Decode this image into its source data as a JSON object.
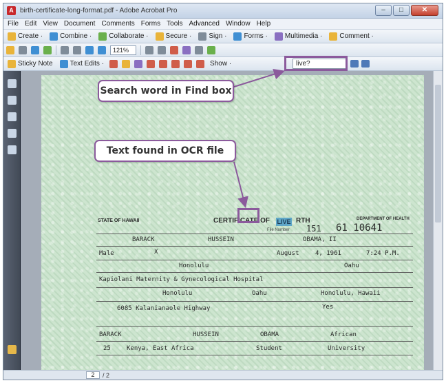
{
  "window": {
    "title": "birth-certificate-long-format.pdf - Adobe Acrobat Pro",
    "controls": {
      "minimize": "–",
      "maximize": "□",
      "close": "✕"
    }
  },
  "menu": [
    "File",
    "Edit",
    "View",
    "Document",
    "Comments",
    "Forms",
    "Tools",
    "Advanced",
    "Window",
    "Help"
  ],
  "toolbar1": {
    "create": "Create ·",
    "combine": "Combine ·",
    "collaborate": "Collaborate ·",
    "secure": "Secure ·",
    "sign": "Sign ·",
    "forms": "Forms ·",
    "multimedia": "Multimedia ·",
    "comment": "Comment ·"
  },
  "toolbar2": {
    "zoom": "121%"
  },
  "toolbar3": {
    "sticky_note": "Sticky Note",
    "text_edits": "Text Edits ·",
    "show": "Show ·",
    "find_value": "live?"
  },
  "callouts": {
    "search": "Search word in Find box",
    "found": "Text found in OCR file"
  },
  "certificate": {
    "state": "STATE OF HAWAII",
    "title_left": "CERTIFICATE OF",
    "found_word": "LIVE",
    "title_right": "RTH",
    "department": "DEPARTMENT OF HEALTH",
    "file_no_label": "File Number",
    "file_no_a": "151",
    "file_no_b": "61 10641",
    "child_first": "BARACK",
    "child_middle": "HUSSEIN",
    "child_last": "OBAMA, II",
    "sex": "Male",
    "single": "X",
    "birth_month_day": "August",
    "birth_date": "4, 1961",
    "birth_time": "7:24 P.M.",
    "island": "Oahu",
    "city": "Honolulu",
    "hospital": "Kapiolani Maternity & Gynecological Hospital",
    "mother_city": "Honolulu",
    "mother_island": "Oahu",
    "mother_state": "Honolulu, Hawaii",
    "street": "6085 Kalanianaole Highway",
    "yes_label": "Yes",
    "father_first": "BARACK",
    "father_middle": "HUSSEIN",
    "father_last": "OBAMA",
    "race": "African",
    "father_age": "25",
    "father_birthplace": "Kenya, East Africa",
    "father_job": "Student",
    "father_business": "University"
  },
  "statusbar": {
    "page_current": "2",
    "page_total": "/ 2"
  }
}
